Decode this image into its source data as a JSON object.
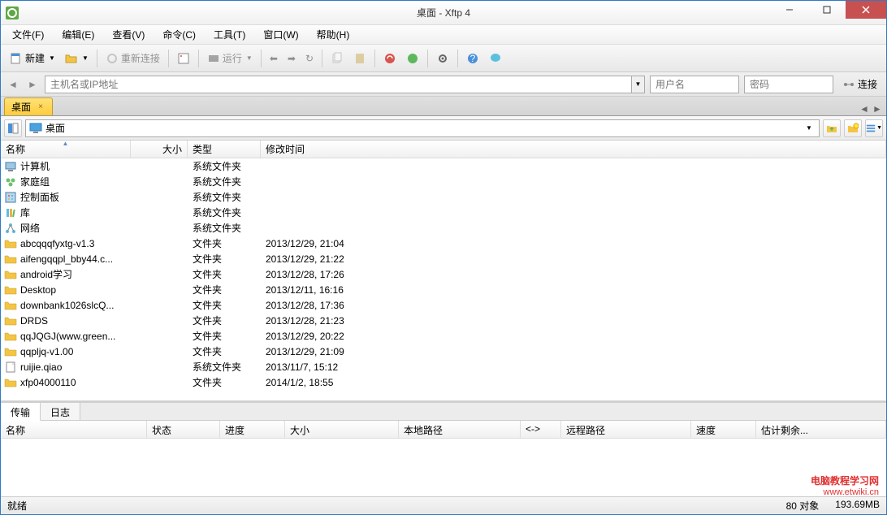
{
  "title": "桌面 - Xftp 4",
  "menu": [
    "文件(F)",
    "编辑(E)",
    "查看(V)",
    "命令(C)",
    "工具(T)",
    "窗口(W)",
    "帮助(H)"
  ],
  "toolbar": {
    "new_label": "新建",
    "reconnect_label": "重新连接",
    "run_label": "运行"
  },
  "addressbar": {
    "host_placeholder": "主机名或IP地址",
    "user_placeholder": "用户名",
    "pass_placeholder": "密码",
    "connect_label": "连接"
  },
  "tab": {
    "label": "桌面"
  },
  "path": {
    "current": "桌面"
  },
  "columns": {
    "name": "名称",
    "size": "大小",
    "type": "类型",
    "date": "修改时间"
  },
  "files": [
    {
      "icon": "computer",
      "name": "计算机",
      "type": "系统文件夹",
      "date": ""
    },
    {
      "icon": "homegroup",
      "name": "家庭组",
      "type": "系统文件夹",
      "date": ""
    },
    {
      "icon": "control",
      "name": "控制面板",
      "type": "系统文件夹",
      "date": ""
    },
    {
      "icon": "library",
      "name": "库",
      "type": "系统文件夹",
      "date": ""
    },
    {
      "icon": "network",
      "name": "网络",
      "type": "系统文件夹",
      "date": ""
    },
    {
      "icon": "folder",
      "name": "abcqqqfyxtg-v1.3",
      "type": "文件夹",
      "date": "2013/12/29, 21:04"
    },
    {
      "icon": "folder",
      "name": "aifengqqpl_bby44.c...",
      "type": "文件夹",
      "date": "2013/12/29, 21:22"
    },
    {
      "icon": "folder",
      "name": "android学习",
      "type": "文件夹",
      "date": "2013/12/28, 17:26"
    },
    {
      "icon": "folder",
      "name": "Desktop",
      "type": "文件夹",
      "date": "2013/12/11, 16:16"
    },
    {
      "icon": "folder",
      "name": "downbank1026slcQ...",
      "type": "文件夹",
      "date": "2013/12/28, 17:36"
    },
    {
      "icon": "folder",
      "name": "DRDS",
      "type": "文件夹",
      "date": "2013/12/28, 21:23"
    },
    {
      "icon": "folder",
      "name": "qqJQGJ(www.green...",
      "type": "文件夹",
      "date": "2013/12/29, 20:22"
    },
    {
      "icon": "folder",
      "name": "qqpljq-v1.00",
      "type": "文件夹",
      "date": "2013/12/29, 21:09"
    },
    {
      "icon": "file",
      "name": "ruijie.qiao",
      "type": "系统文件夹",
      "date": "2013/11/7, 15:12"
    },
    {
      "icon": "folder",
      "name": "xfp04000110",
      "type": "文件夹",
      "date": "2014/1/2, 18:55"
    }
  ],
  "transfer": {
    "tabs": [
      "传输",
      "日志"
    ],
    "cols": {
      "name": "名称",
      "status": "状态",
      "progress": "进度",
      "size": "大小",
      "local": "本地路径",
      "dir": "<->",
      "remote": "远程路径",
      "speed": "速度",
      "eta": "估计剩余..."
    }
  },
  "status": {
    "ready": "就绪",
    "objects": "80 对象",
    "size": "193.69MB"
  },
  "watermark": {
    "main": "电脑教程学习网",
    "sub": "www.etwiki.cn"
  }
}
